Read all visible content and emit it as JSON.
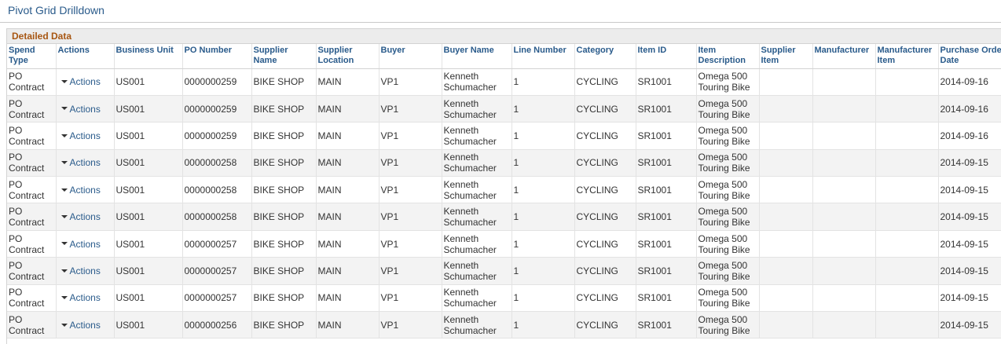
{
  "page": {
    "title": "Pivot Grid Drilldown"
  },
  "panel": {
    "title": "Detailed Data"
  },
  "table": {
    "columns": [
      "Spend Type",
      "Actions",
      "Business Unit",
      "PO Number",
      "Supplier Name",
      "Supplier Location",
      "Buyer",
      "Buyer Name",
      "Line Number",
      "Category",
      "Item ID",
      "Item Description",
      "Supplier Item",
      "Manufacturer",
      "Manufacturer Item",
      "Purchase Order Date"
    ],
    "rows": [
      {
        "spend_type": "PO Contract",
        "actions": "Actions",
        "business_unit": "US001",
        "po_number": "0000000259",
        "supplier_name": "BIKE SHOP",
        "supplier_location": "MAIN",
        "buyer": "VP1",
        "buyer_name": "Kenneth Schumacher",
        "line_number": "1",
        "category": "CYCLING",
        "item_id": "SR1001",
        "item_description": "Omega 500 Touring Bike",
        "supplier_item": "",
        "manufacturer": "",
        "manufacturer_item": "",
        "po_date": "2014-09-16"
      },
      {
        "spend_type": "PO Contract",
        "actions": "Actions",
        "business_unit": "US001",
        "po_number": "0000000259",
        "supplier_name": "BIKE SHOP",
        "supplier_location": "MAIN",
        "buyer": "VP1",
        "buyer_name": "Kenneth Schumacher",
        "line_number": "1",
        "category": "CYCLING",
        "item_id": "SR1001",
        "item_description": "Omega 500 Touring Bike",
        "supplier_item": "",
        "manufacturer": "",
        "manufacturer_item": "",
        "po_date": "2014-09-16"
      },
      {
        "spend_type": "PO Contract",
        "actions": "Actions",
        "business_unit": "US001",
        "po_number": "0000000259",
        "supplier_name": "BIKE SHOP",
        "supplier_location": "MAIN",
        "buyer": "VP1",
        "buyer_name": "Kenneth Schumacher",
        "line_number": "1",
        "category": "CYCLING",
        "item_id": "SR1001",
        "item_description": "Omega 500 Touring Bike",
        "supplier_item": "",
        "manufacturer": "",
        "manufacturer_item": "",
        "po_date": "2014-09-16"
      },
      {
        "spend_type": "PO Contract",
        "actions": "Actions",
        "business_unit": "US001",
        "po_number": "0000000258",
        "supplier_name": "BIKE SHOP",
        "supplier_location": "MAIN",
        "buyer": "VP1",
        "buyer_name": "Kenneth Schumacher",
        "line_number": "1",
        "category": "CYCLING",
        "item_id": "SR1001",
        "item_description": "Omega 500 Touring Bike",
        "supplier_item": "",
        "manufacturer": "",
        "manufacturer_item": "",
        "po_date": "2014-09-15"
      },
      {
        "spend_type": "PO Contract",
        "actions": "Actions",
        "business_unit": "US001",
        "po_number": "0000000258",
        "supplier_name": "BIKE SHOP",
        "supplier_location": "MAIN",
        "buyer": "VP1",
        "buyer_name": "Kenneth Schumacher",
        "line_number": "1",
        "category": "CYCLING",
        "item_id": "SR1001",
        "item_description": "Omega 500 Touring Bike",
        "supplier_item": "",
        "manufacturer": "",
        "manufacturer_item": "",
        "po_date": "2014-09-15"
      },
      {
        "spend_type": "PO Contract",
        "actions": "Actions",
        "business_unit": "US001",
        "po_number": "0000000258",
        "supplier_name": "BIKE SHOP",
        "supplier_location": "MAIN",
        "buyer": "VP1",
        "buyer_name": "Kenneth Schumacher",
        "line_number": "1",
        "category": "CYCLING",
        "item_id": "SR1001",
        "item_description": "Omega 500 Touring Bike",
        "supplier_item": "",
        "manufacturer": "",
        "manufacturer_item": "",
        "po_date": "2014-09-15"
      },
      {
        "spend_type": "PO Contract",
        "actions": "Actions",
        "business_unit": "US001",
        "po_number": "0000000257",
        "supplier_name": "BIKE SHOP",
        "supplier_location": "MAIN",
        "buyer": "VP1",
        "buyer_name": "Kenneth Schumacher",
        "line_number": "1",
        "category": "CYCLING",
        "item_id": "SR1001",
        "item_description": "Omega 500 Touring Bike",
        "supplier_item": "",
        "manufacturer": "",
        "manufacturer_item": "",
        "po_date": "2014-09-15"
      },
      {
        "spend_type": "PO Contract",
        "actions": "Actions",
        "business_unit": "US001",
        "po_number": "0000000257",
        "supplier_name": "BIKE SHOP",
        "supplier_location": "MAIN",
        "buyer": "VP1",
        "buyer_name": "Kenneth Schumacher",
        "line_number": "1",
        "category": "CYCLING",
        "item_id": "SR1001",
        "item_description": "Omega 500 Touring Bike",
        "supplier_item": "",
        "manufacturer": "",
        "manufacturer_item": "",
        "po_date": "2014-09-15"
      },
      {
        "spend_type": "PO Contract",
        "actions": "Actions",
        "business_unit": "US001",
        "po_number": "0000000257",
        "supplier_name": "BIKE SHOP",
        "supplier_location": "MAIN",
        "buyer": "VP1",
        "buyer_name": "Kenneth Schumacher",
        "line_number": "1",
        "category": "CYCLING",
        "item_id": "SR1001",
        "item_description": "Omega 500 Touring Bike",
        "supplier_item": "",
        "manufacturer": "",
        "manufacturer_item": "",
        "po_date": "2014-09-15"
      },
      {
        "spend_type": "PO Contract",
        "actions": "Actions",
        "business_unit": "US001",
        "po_number": "0000000256",
        "supplier_name": "BIKE SHOP",
        "supplier_location": "MAIN",
        "buyer": "VP1",
        "buyer_name": "Kenneth Schumacher",
        "line_number": "1",
        "category": "CYCLING",
        "item_id": "SR1001",
        "item_description": "Omega 500 Touring Bike",
        "supplier_item": "",
        "manufacturer": "",
        "manufacturer_item": "",
        "po_date": "2014-09-15"
      }
    ]
  },
  "colors": {
    "link": "#2a5b8b",
    "panel_title": "#a75612",
    "alt_row": "#f3f3f3"
  }
}
